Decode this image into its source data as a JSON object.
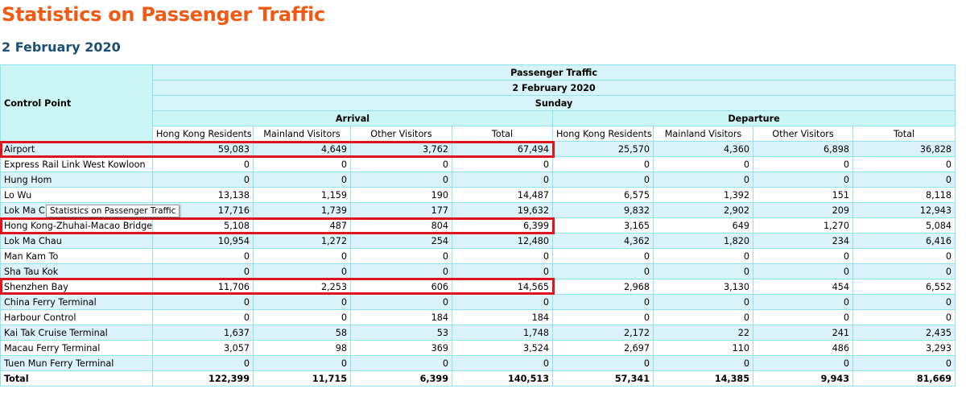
{
  "page": {
    "title": "Statistics on Passenger Traffic",
    "date": "2 February 2020"
  },
  "table": {
    "control_point_header": "Control Point",
    "header_group": "Passenger Traffic",
    "header_date": "2 February 2020",
    "header_day": "Sunday",
    "arrival_label": "Arrival",
    "departure_label": "Departure",
    "columns": [
      "Hong Kong Residents",
      "Mainland Visitors",
      "Other Visitors",
      "Total",
      "Hong Kong Residents",
      "Mainland Visitors",
      "Other Visitors",
      "Total"
    ],
    "rows": [
      {
        "name": "Airport",
        "values": [
          "59,083",
          "4,649",
          "3,762",
          "67,494",
          "25,570",
          "4,360",
          "6,898",
          "36,828"
        ]
      },
      {
        "name": "Express Rail Link West Kowloon",
        "values": [
          "0",
          "0",
          "0",
          "0",
          "0",
          "0",
          "0",
          "0"
        ]
      },
      {
        "name": "Hung Hom",
        "values": [
          "0",
          "0",
          "0",
          "0",
          "0",
          "0",
          "0",
          "0"
        ]
      },
      {
        "name": "Lo Wu",
        "values": [
          "13,138",
          "1,159",
          "190",
          "14,487",
          "6,575",
          "1,392",
          "151",
          "8,118"
        ]
      },
      {
        "name": "Lok Ma C",
        "values": [
          "17,716",
          "1,739",
          "177",
          "19,632",
          "9,832",
          "2,902",
          "209",
          "12,943"
        ]
      },
      {
        "name": "Hong Kong-Zhuhai-Macao Bridge",
        "values": [
          "5,108",
          "487",
          "804",
          "6,399",
          "3,165",
          "649",
          "1,270",
          "5,084"
        ]
      },
      {
        "name": "Lok Ma Chau",
        "values": [
          "10,954",
          "1,272",
          "254",
          "12,480",
          "4,362",
          "1,820",
          "234",
          "6,416"
        ]
      },
      {
        "name": "Man Kam To",
        "values": [
          "0",
          "0",
          "0",
          "0",
          "0",
          "0",
          "0",
          "0"
        ]
      },
      {
        "name": "Sha Tau Kok",
        "values": [
          "0",
          "0",
          "0",
          "0",
          "0",
          "0",
          "0",
          "0"
        ]
      },
      {
        "name": "Shenzhen Bay",
        "values": [
          "11,706",
          "2,253",
          "606",
          "14,565",
          "2,968",
          "3,130",
          "454",
          "6,552"
        ]
      },
      {
        "name": "China Ferry Terminal",
        "values": [
          "0",
          "0",
          "0",
          "0",
          "0",
          "0",
          "0",
          "0"
        ]
      },
      {
        "name": "Harbour Control",
        "values": [
          "0",
          "0",
          "184",
          "184",
          "0",
          "0",
          "0",
          "0"
        ]
      },
      {
        "name": "Kai Tak Cruise Terminal",
        "values": [
          "1,637",
          "58",
          "53",
          "1,748",
          "2,172",
          "22",
          "241",
          "2,435"
        ]
      },
      {
        "name": "Macau Ferry Terminal",
        "values": [
          "3,057",
          "98",
          "369",
          "3,524",
          "2,697",
          "110",
          "486",
          "3,293"
        ]
      },
      {
        "name": "Tuen Mun Ferry Terminal",
        "values": [
          "0",
          "0",
          "0",
          "0",
          "0",
          "0",
          "0",
          "0"
        ]
      }
    ],
    "total": {
      "name": "Total",
      "values": [
        "122,399",
        "11,715",
        "6,399",
        "140,513",
        "57,341",
        "14,385",
        "9,943",
        "81,669"
      ]
    }
  },
  "tooltip": "Statistics on Passenger Traffic",
  "highlight_color": "#e0141c",
  "title_color": "#f05a14",
  "date_color": "#1c4f73"
}
